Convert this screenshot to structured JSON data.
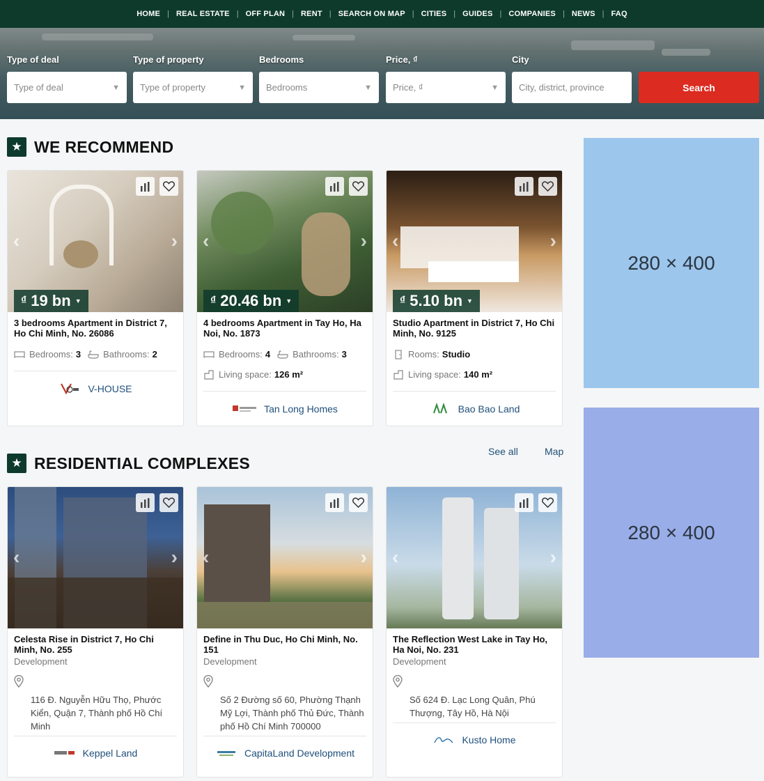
{
  "nav": [
    "HOME",
    "REAL ESTATE",
    "OFF PLAN",
    "RENT",
    "SEARCH ON MAP",
    "CITIES",
    "GUIDES",
    "COMPANIES",
    "NEWS",
    "FAQ"
  ],
  "filters": {
    "deal_label": "Type of deal",
    "deal_placeholder": "Type of deal",
    "property_label": "Type of property",
    "property_placeholder": "Type of property",
    "bedrooms_label": "Bedrooms",
    "bedrooms_placeholder": "Bedrooms",
    "price_label": "Price, ₫",
    "price_placeholder": "Price, ₫",
    "city_label": "City",
    "city_placeholder": "City, district, province",
    "search_label": "Search"
  },
  "recommend": {
    "title": "WE RECOMMEND",
    "cards": [
      {
        "currency": "₫",
        "price": "19 bn",
        "title": "3 bedrooms Apartment in District 7, Ho Chi Minh, No. 26086",
        "f1_label": "Bedrooms:",
        "f1_value": "3",
        "f2_label": "Bathrooms:",
        "f2_value": "2",
        "agency": "V-HOUSE"
      },
      {
        "currency": "₫",
        "price": "20.46 bn",
        "title": "4 bedrooms Apartment in Tay Ho, Ha Noi, No. 1873",
        "f1_label": "Bedrooms:",
        "f1_value": "4",
        "f2_label": "Bathrooms:",
        "f2_value": "3",
        "f3_label": "Living space:",
        "f3_value": "126 m²",
        "agency": "Tan Long Homes"
      },
      {
        "currency": "₫",
        "price": "5.10 bn",
        "title": "Studio Apartment in District 7, Ho Chi Minh, No. 9125",
        "f1_label": "Rooms:",
        "f1_value": "Studio",
        "f3_label": "Living space:",
        "f3_value": "140 m²",
        "agency": "Bao Bao Land"
      }
    ]
  },
  "complexes": {
    "title": "RESIDENTIAL COMPLEXES",
    "see_all": "See all",
    "map": "Map",
    "cards": [
      {
        "title": "Celesta Rise in District 7, Ho Chi Minh, No. 255",
        "status": "Development",
        "address": "116 Đ. Nguyễn Hữu Thọ, Phước Kiển, Quận 7, Thành phố Hồ Chí Minh",
        "agency": "Keppel Land"
      },
      {
        "title": "Define in Thu Duc, Ho Chi Minh, No. 151",
        "status": "Development",
        "address": "Số 2 Đường số 60, Phường Thạnh Mỹ Lợi, Thành phố Thủ Đức, Thành phố Hồ Chí Minh 700000",
        "agency": "CapitaLand Development"
      },
      {
        "title": "The Reflection West Lake in Tay Ho, Ha Noi, No. 231",
        "status": "Development",
        "address": "Số 624 Đ. Lạc Long Quân, Phú Thượng, Tây Hồ, Hà Nội",
        "agency": "Kusto Home"
      }
    ]
  },
  "ads": [
    {
      "text": "280 × 400",
      "color": "#9cc6ec"
    },
    {
      "text": "280 × 400",
      "color": "#99ade8"
    }
  ],
  "colors": {
    "brand": "#0e3a2c",
    "accent": "#dc2b20",
    "link": "#1f4f7a"
  }
}
